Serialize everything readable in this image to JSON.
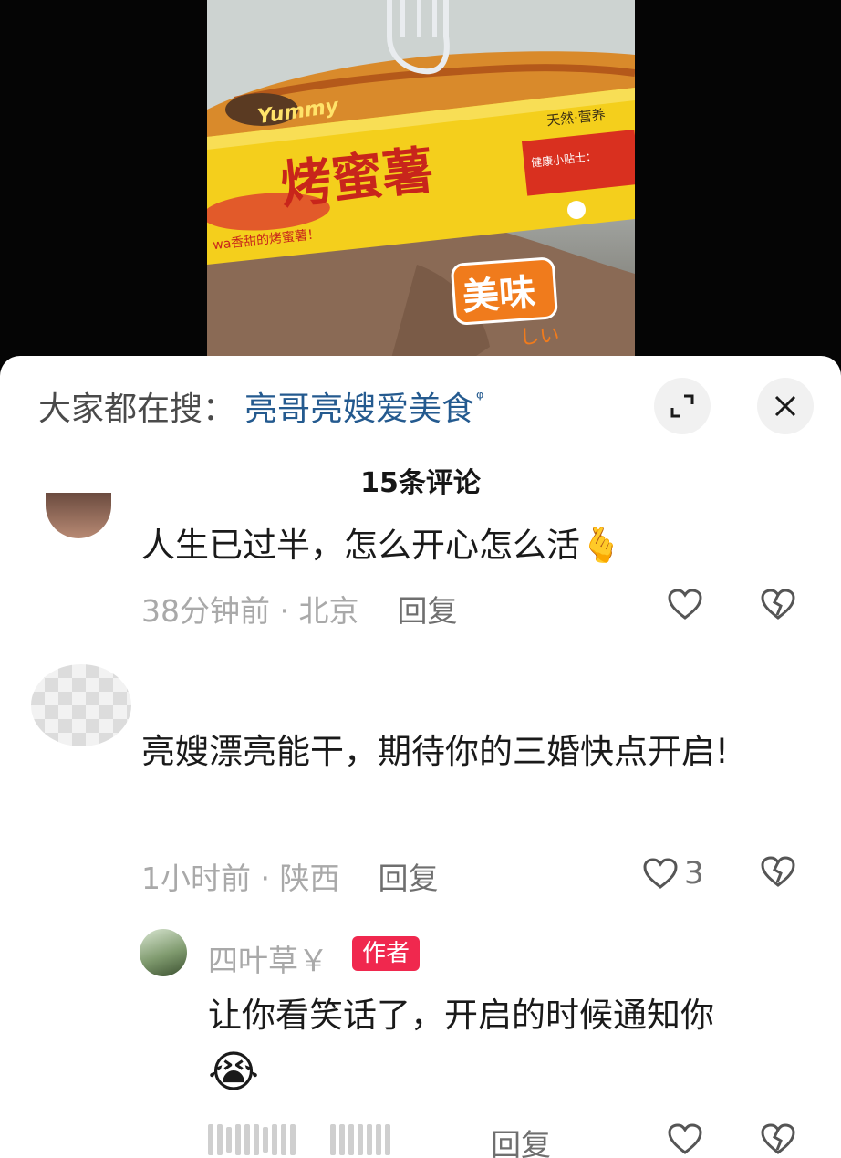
{
  "video": {
    "box_title": "烤蜜薯",
    "box_tagline": "天然·营养",
    "box_subline": "wa香甜的烤蜜薯！",
    "box_note_title": "健康小贴士：",
    "sticker_yummy": "Yummy",
    "sticker_meiwei": "美味",
    "sticker_oishii": "しい"
  },
  "search": {
    "prefix": "大家都在搜：",
    "term": "亮哥亮嫂爱美食",
    "glyph": "ᵠ"
  },
  "comments_header": {
    "title": "15条评论"
  },
  "comments": [
    {
      "text": "人生已过半，怎么开心怎么活",
      "emoji": "🫰",
      "time_location": "38分钟前 · 北京",
      "reply_label": "回复",
      "like_count": ""
    },
    {
      "text": "亮嫂漂亮能干，期待你的三婚快点开启!",
      "time_location": "1小时前 · 陕西",
      "reply_label": "回复",
      "like_count": "3"
    }
  ],
  "author_reply": {
    "name": "四叶草￥",
    "badge": "作者",
    "text": "让你看笑话了，开启的时候通知你",
    "emoji": "😭",
    "reply_label": "回复"
  },
  "colors": {
    "accent_link": "#245a8f",
    "author_badge": "#f0284e",
    "secondary_text": "#a9a9a9",
    "box_yellow": "#f4cf1c"
  }
}
